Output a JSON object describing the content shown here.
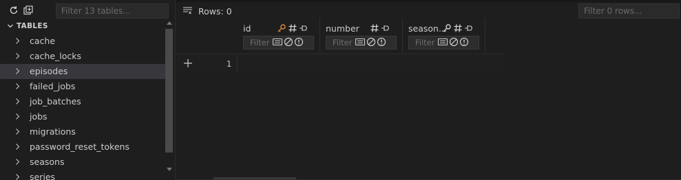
{
  "sidebar": {
    "filter_placeholder": "Filter 13 tables...",
    "section_title": "TABLES",
    "tables": [
      {
        "name": "cache"
      },
      {
        "name": "cache_locks"
      },
      {
        "name": "episodes",
        "selected": true
      },
      {
        "name": "failed_jobs"
      },
      {
        "name": "job_batches"
      },
      {
        "name": "jobs"
      },
      {
        "name": "migrations"
      },
      {
        "name": "password_reset_tokens"
      },
      {
        "name": "seasons"
      },
      {
        "name": "series"
      }
    ]
  },
  "main": {
    "rows_label": "Rows: 0",
    "filter_placeholder": "Filter 0 rows...",
    "columns": [
      {
        "name": "id",
        "icons": [
          "key-icon",
          "hash-icon",
          "pin-icon"
        ],
        "filter_placeholder": "Filter"
      },
      {
        "name": "number",
        "icons": [
          "hash-icon",
          "pin-icon"
        ],
        "filter_placeholder": "Filter"
      },
      {
        "name": "season...",
        "icons": [
          "key-icon",
          "hash-icon",
          "pin-icon"
        ],
        "filter_placeholder": "Filter"
      }
    ],
    "row_number": "1"
  },
  "colors": {
    "background": "#1e1e1e",
    "key_icon": "#e0883b",
    "selected_row": "#37373d"
  }
}
